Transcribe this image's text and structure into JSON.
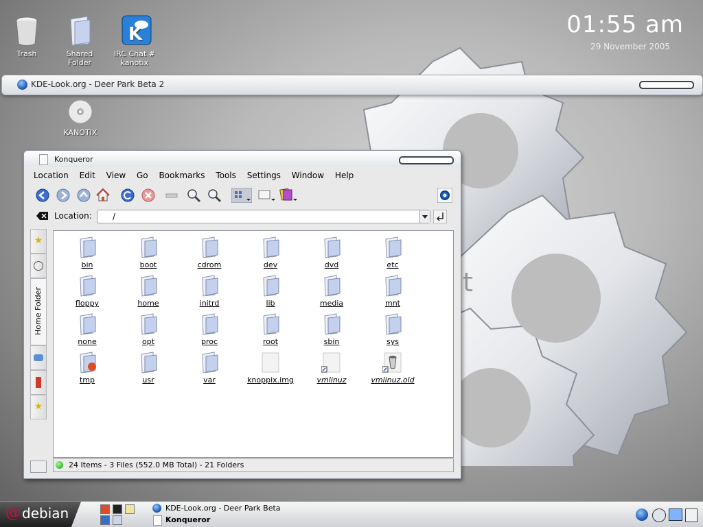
{
  "desktop": {
    "icons": [
      {
        "label": "Trash"
      },
      {
        "label": "Shared\nFolder"
      },
      {
        "label": "IRC Chat #\nkanotix"
      },
      {
        "label": "KANOTIX"
      }
    ],
    "clock": {
      "time": "01:55 am",
      "date": "29 November 2005"
    },
    "wallpaper_text": "nt"
  },
  "minimized_window": {
    "title": "KDE-Look.org - Deer Park Beta 2"
  },
  "konqueror": {
    "title": "Konqueror",
    "menu": [
      "Location",
      "Edit",
      "View",
      "Go",
      "Bookmarks",
      "Tools",
      "Settings",
      "Window",
      "Help"
    ],
    "toolbar_icons": [
      "back-icon",
      "forward-icon",
      "up-icon",
      "home-icon",
      "reload-icon",
      "stop-icon",
      "cut-icon",
      "zoom-in-icon",
      "zoom-out-icon",
      "icon-view-icon",
      "list-view-icon",
      "preview-icon",
      "gear-icon"
    ],
    "location": {
      "label": "Location:",
      "value": "/"
    },
    "sidebar": {
      "tab_label": "Home Folder"
    },
    "files": [
      {
        "name": "bin",
        "type": "folder"
      },
      {
        "name": "boot",
        "type": "folder"
      },
      {
        "name": "cdrom",
        "type": "folder"
      },
      {
        "name": "dev",
        "type": "folder"
      },
      {
        "name": "dvd",
        "type": "folder"
      },
      {
        "name": "etc",
        "type": "folder"
      },
      {
        "name": "floppy",
        "type": "folder"
      },
      {
        "name": "home",
        "type": "folder"
      },
      {
        "name": "initrd",
        "type": "folder"
      },
      {
        "name": "lib",
        "type": "folder"
      },
      {
        "name": "media",
        "type": "folder"
      },
      {
        "name": "mnt",
        "type": "folder"
      },
      {
        "name": "none",
        "type": "folder"
      },
      {
        "name": "opt",
        "type": "folder"
      },
      {
        "name": "proc",
        "type": "folder"
      },
      {
        "name": "root",
        "type": "folder"
      },
      {
        "name": "sbin",
        "type": "folder"
      },
      {
        "name": "sys",
        "type": "folder"
      },
      {
        "name": "tmp",
        "type": "folder-special"
      },
      {
        "name": "usr",
        "type": "folder"
      },
      {
        "name": "var",
        "type": "folder"
      },
      {
        "name": "knoppix.img",
        "type": "file"
      },
      {
        "name": "vmlinuz",
        "type": "link"
      },
      {
        "name": "vmlinuz.old",
        "type": "link-bin"
      }
    ],
    "status": "24 Items - 3 Files (552.0 MB Total) - 21 Folders"
  },
  "taskbar": {
    "start_label": "debian",
    "tasks": [
      {
        "label": "KDE-Look.org - Deer Park Beta"
      },
      {
        "label": "Konqueror"
      }
    ]
  }
}
